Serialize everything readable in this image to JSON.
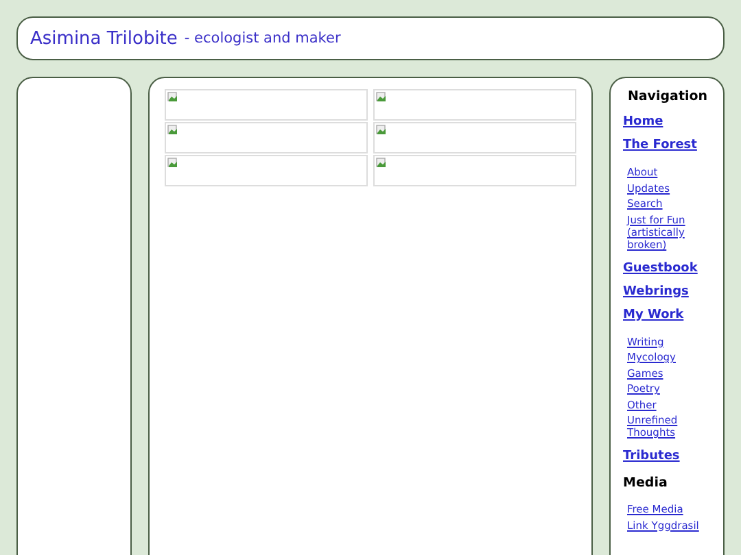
{
  "header": {
    "title": "Asimina Trilobite",
    "subtitle": "- ecologist and maker"
  },
  "gallery": [
    {
      "kind": "broken_image"
    },
    {
      "kind": "broken_image"
    },
    {
      "kind": "broken_image"
    },
    {
      "kind": "broken_image"
    },
    {
      "kind": "broken_image"
    },
    {
      "kind": "broken_image"
    }
  ],
  "navigation": [
    {
      "kind": "heading",
      "label": "Navigation"
    },
    {
      "kind": "link",
      "label": "Home"
    },
    {
      "kind": "link",
      "label": "The Forest"
    },
    {
      "kind": "sublink",
      "label": "About"
    },
    {
      "kind": "sublink",
      "label": "Updates"
    },
    {
      "kind": "sublink",
      "label": "Search"
    },
    {
      "kind": "sublink",
      "label": "Just for Fun (artistically broken)"
    },
    {
      "kind": "link",
      "label": "Guestbook"
    },
    {
      "kind": "link",
      "label": "Webrings"
    },
    {
      "kind": "link",
      "label": "My Work"
    },
    {
      "kind": "sublink",
      "label": "Writing"
    },
    {
      "kind": "sublink",
      "label": "Mycology"
    },
    {
      "kind": "sublink",
      "label": "Games"
    },
    {
      "kind": "sublink",
      "label": "Poetry"
    },
    {
      "kind": "sublink",
      "label": "Other"
    },
    {
      "kind": "sublink",
      "label": "Unrefined Thoughts"
    },
    {
      "kind": "link",
      "label": "Tributes"
    },
    {
      "kind": "heading",
      "label": "Media"
    },
    {
      "kind": "sublink",
      "label": "Free Media"
    },
    {
      "kind": "sublink",
      "label": "Link Yggdrasil"
    }
  ]
}
